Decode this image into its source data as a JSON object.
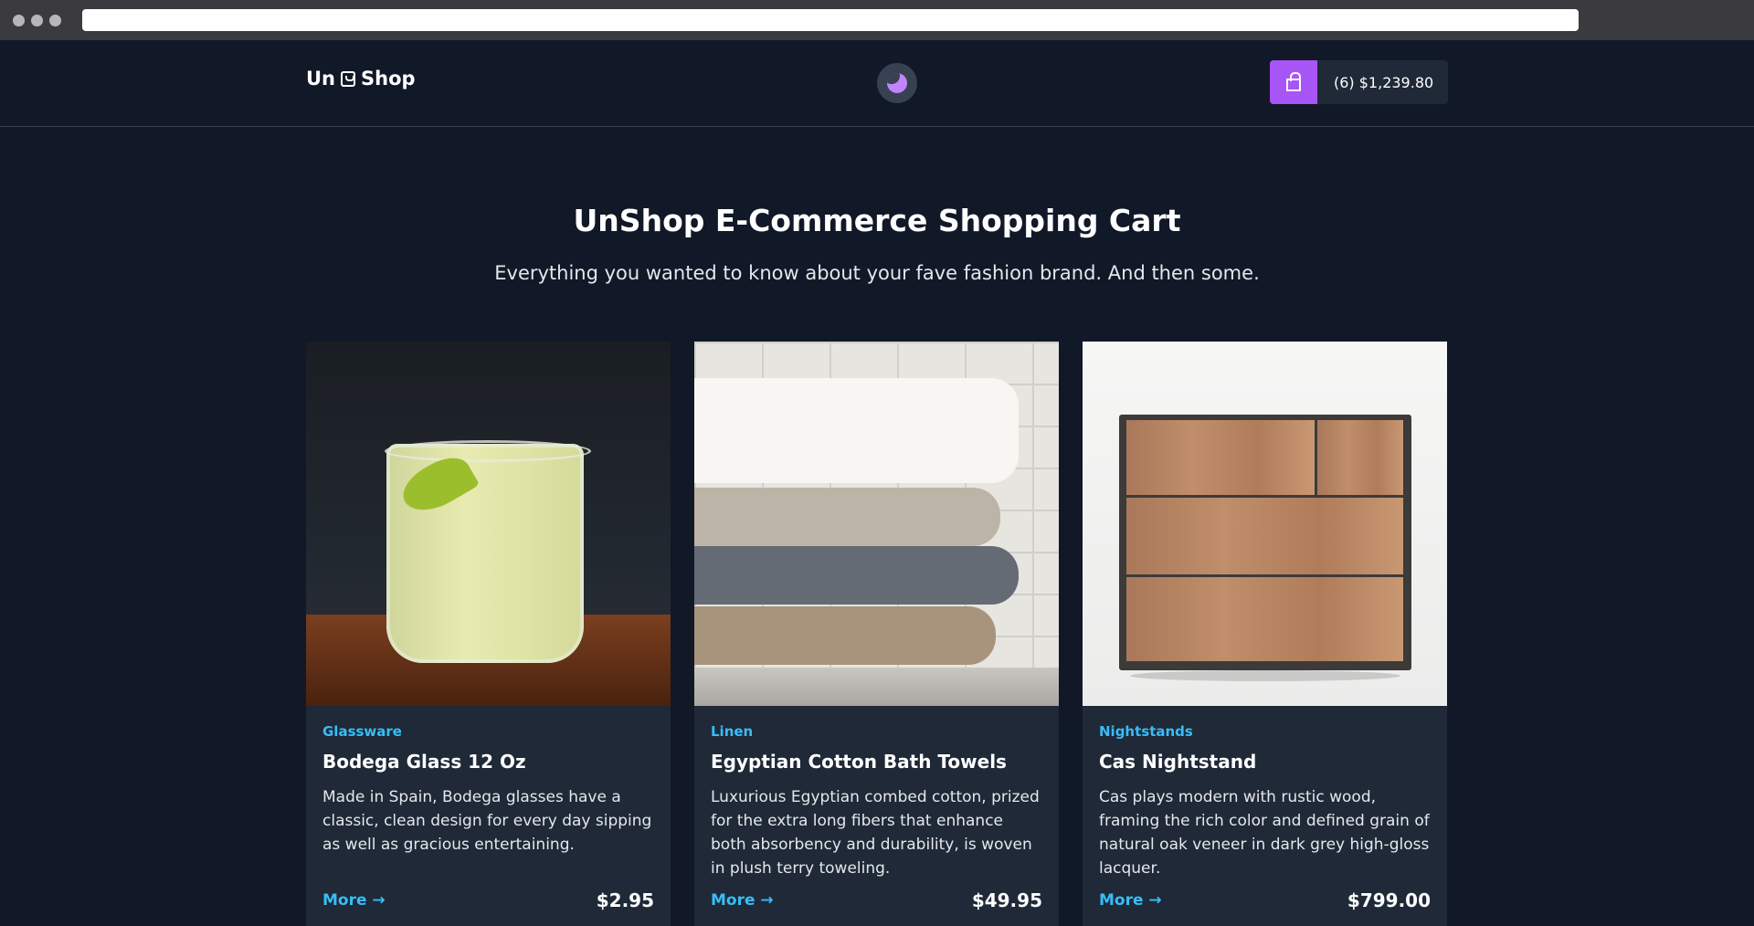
{
  "header": {
    "logo_left": "Un",
    "logo_right": "Shop",
    "cart_label": "(6) $1,239.80"
  },
  "hero": {
    "title": "UnShop E-Commerce Shopping Cart",
    "subtitle": "Everything you wanted to know about your fave fashion brand. And then some."
  },
  "products": [
    {
      "category": "Glassware",
      "name": "Bodega Glass 12 Oz",
      "description": "Made in Spain, Bodega glasses have a classic, clean design for every day sipping as well as gracious entertaining.",
      "more": "More →",
      "price": "$2.95"
    },
    {
      "category": "Linen",
      "name": "Egyptian Cotton Bath Towels",
      "description": "Luxurious Egyptian combed cotton, prized for the extra long fibers that enhance both absorbency and durability, is woven in plush terry toweling.",
      "more": "More →",
      "price": "$49.95"
    },
    {
      "category": "Nightstands",
      "name": "Cas Nightstand",
      "description": "Cas plays modern with rustic wood, framing the rich color and defined grain of natural oak veneer in dark grey high-gloss lacquer.",
      "more": "More →",
      "price": "$799.00"
    }
  ],
  "colors": {
    "background": "#111827",
    "card": "#1f2937",
    "accent_purple": "#a855f7",
    "link_blue": "#38bdf8"
  },
  "icons": [
    "shopping-bag-icon",
    "moon-icon"
  ]
}
